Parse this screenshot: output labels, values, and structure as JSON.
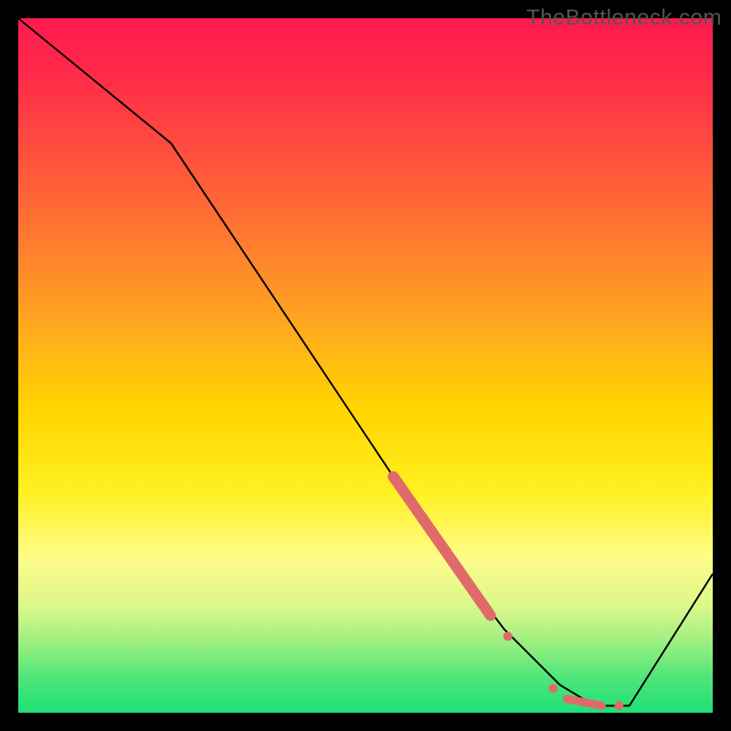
{
  "watermark": "TheBottleneck.com",
  "chart_data": {
    "type": "line",
    "title": "",
    "xlabel": "",
    "ylabel": "",
    "xlim": [
      0,
      100
    ],
    "ylim": [
      0,
      100
    ],
    "grid": false,
    "curve": {
      "name": "bottleneck-curve",
      "color": "#000000",
      "x": [
        0,
        22,
        60,
        70,
        78,
        83,
        88,
        100
      ],
      "y": [
        100,
        82,
        25,
        12,
        4,
        1,
        1,
        20
      ]
    },
    "highlight_segments": [
      {
        "name": "thick-segment",
        "color": "#e06a6a",
        "width": 12,
        "x": [
          54,
          68
        ],
        "y": [
          34,
          14
        ]
      },
      {
        "name": "dot-a",
        "color": "#e06a6a",
        "r": 5,
        "x": 70.5,
        "y": 11
      },
      {
        "name": "dot-b",
        "color": "#e06a6a",
        "r": 5,
        "x": 77,
        "y": 3.5
      },
      {
        "name": "short-seg",
        "color": "#e06a6a",
        "width": 9,
        "x": [
          79,
          84
        ],
        "y": [
          2,
          1
        ]
      },
      {
        "name": "dot-c",
        "color": "#e06a6a",
        "r": 5,
        "x": 86.5,
        "y": 1
      }
    ]
  },
  "gradient_stops": [
    {
      "pct": 0,
      "color": "#ff1a4e"
    },
    {
      "pct": 50,
      "color": "#ffd400"
    },
    {
      "pct": 95,
      "color": "#4ee57a"
    },
    {
      "pct": 100,
      "color": "#1fe07a"
    }
  ]
}
